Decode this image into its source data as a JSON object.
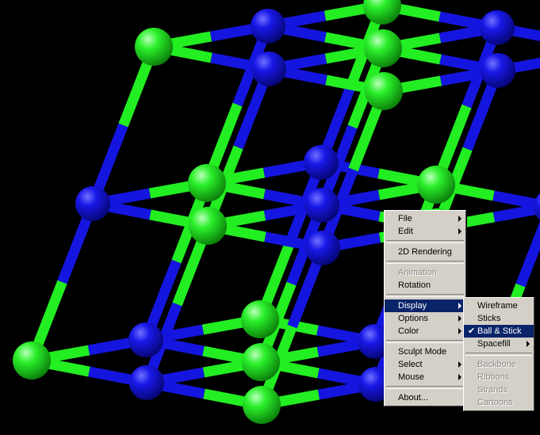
{
  "viewer": {
    "atom_colors": {
      "green": "#22ee22",
      "blue": "#1515e0",
      "background": "#000000"
    }
  },
  "context_menu": {
    "items": [
      {
        "label": "File",
        "submenu": true
      },
      {
        "label": "Edit",
        "submenu": true
      },
      {
        "label": "2D Rendering"
      },
      {
        "label": "Animation",
        "disabled": true
      },
      {
        "label": "Rotation"
      },
      {
        "label": "Display",
        "submenu": true,
        "active": true
      },
      {
        "label": "Options",
        "submenu": true
      },
      {
        "label": "Color",
        "submenu": true
      },
      {
        "label": "Sculpt Mode"
      },
      {
        "label": "Select",
        "submenu": true
      },
      {
        "label": "Mouse",
        "submenu": true
      },
      {
        "label": "About..."
      }
    ]
  },
  "display_submenu": {
    "items": [
      {
        "label": "Wireframe"
      },
      {
        "label": "Sticks"
      },
      {
        "label": "Ball & Stick",
        "checked": true,
        "active": true,
        "check_mark": "✔"
      },
      {
        "label": "Spacefill",
        "submenu": true
      },
      {
        "label": "Backbone",
        "disabled": true
      },
      {
        "label": "Ribbons",
        "disabled": true
      },
      {
        "label": "Strands",
        "disabled": true
      },
      {
        "label": "Cartoons",
        "disabled": true
      }
    ]
  }
}
